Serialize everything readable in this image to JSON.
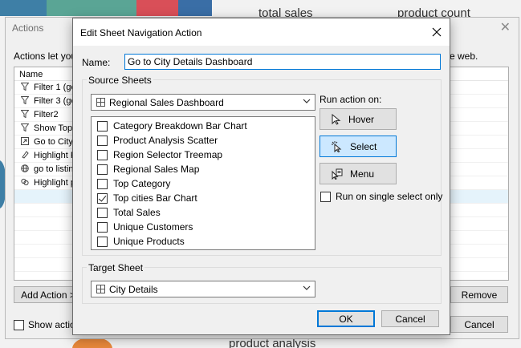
{
  "background": {
    "tile_colors": [
      "#3e7fa6",
      "#5aa595",
      "#d94f58",
      "#3a6ea6",
      "#f0f0f0"
    ],
    "caption_total_sales": "total sales",
    "caption_product_count": "product count",
    "caption_product_analysis": "product analysis"
  },
  "actions_window": {
    "title": "Actions",
    "intro_text": "Actions let you",
    "intro_tail": "e web.",
    "list_header": "Name",
    "rows": [
      {
        "icon": "filter-icon",
        "label": "Filter 1 (ge"
      },
      {
        "icon": "filter-icon",
        "label": "Filter 3 (ge"
      },
      {
        "icon": "filter-icon",
        "label": "Filter2"
      },
      {
        "icon": "filter-icon",
        "label": "Show Top"
      },
      {
        "icon": "go-to-sheet-icon",
        "label": "Go to City"
      },
      {
        "icon": "highlight-icon",
        "label": "Highlight P"
      },
      {
        "icon": "globe-icon",
        "label": "go to listin"
      },
      {
        "icon": "link-icon",
        "label": "Highlight pr"
      }
    ],
    "row_right_text": "e",
    "add_action_label": "Add Action >",
    "remove_label": "Remove",
    "show_actions_label": "Show action",
    "cancel_label": "Cancel"
  },
  "dialog": {
    "title": "Edit Sheet Navigation Action",
    "name_label": "Name:",
    "name_value": "Go to City Details Dashboard",
    "source_group_label": "Source Sheets",
    "source_dashboard": "Regional Sales Dashboard",
    "sheets": [
      {
        "label": "Category Breakdown Bar Chart",
        "checked": false
      },
      {
        "label": "Product Analysis Scatter",
        "checked": false
      },
      {
        "label": "Region Selector Treemap",
        "checked": false
      },
      {
        "label": "Regional Sales Map",
        "checked": false
      },
      {
        "label": "Top Category",
        "checked": false
      },
      {
        "label": "Top cities Bar Chart",
        "checked": true
      },
      {
        "label": "Total Sales",
        "checked": false
      },
      {
        "label": "Unique Customers",
        "checked": false
      },
      {
        "label": "Unique Products",
        "checked": false
      }
    ],
    "run_action_label": "Run action on:",
    "hover_label": "Hover",
    "select_label": "Select",
    "menu_label": "Menu",
    "run_single_label": "Run on single select only",
    "target_group_label": "Target Sheet",
    "target_sheet": "City Details",
    "ok_label": "OK",
    "cancel_label": "Cancel",
    "accent_color": "#0078d7",
    "selected_bg": "#cce8ff"
  }
}
